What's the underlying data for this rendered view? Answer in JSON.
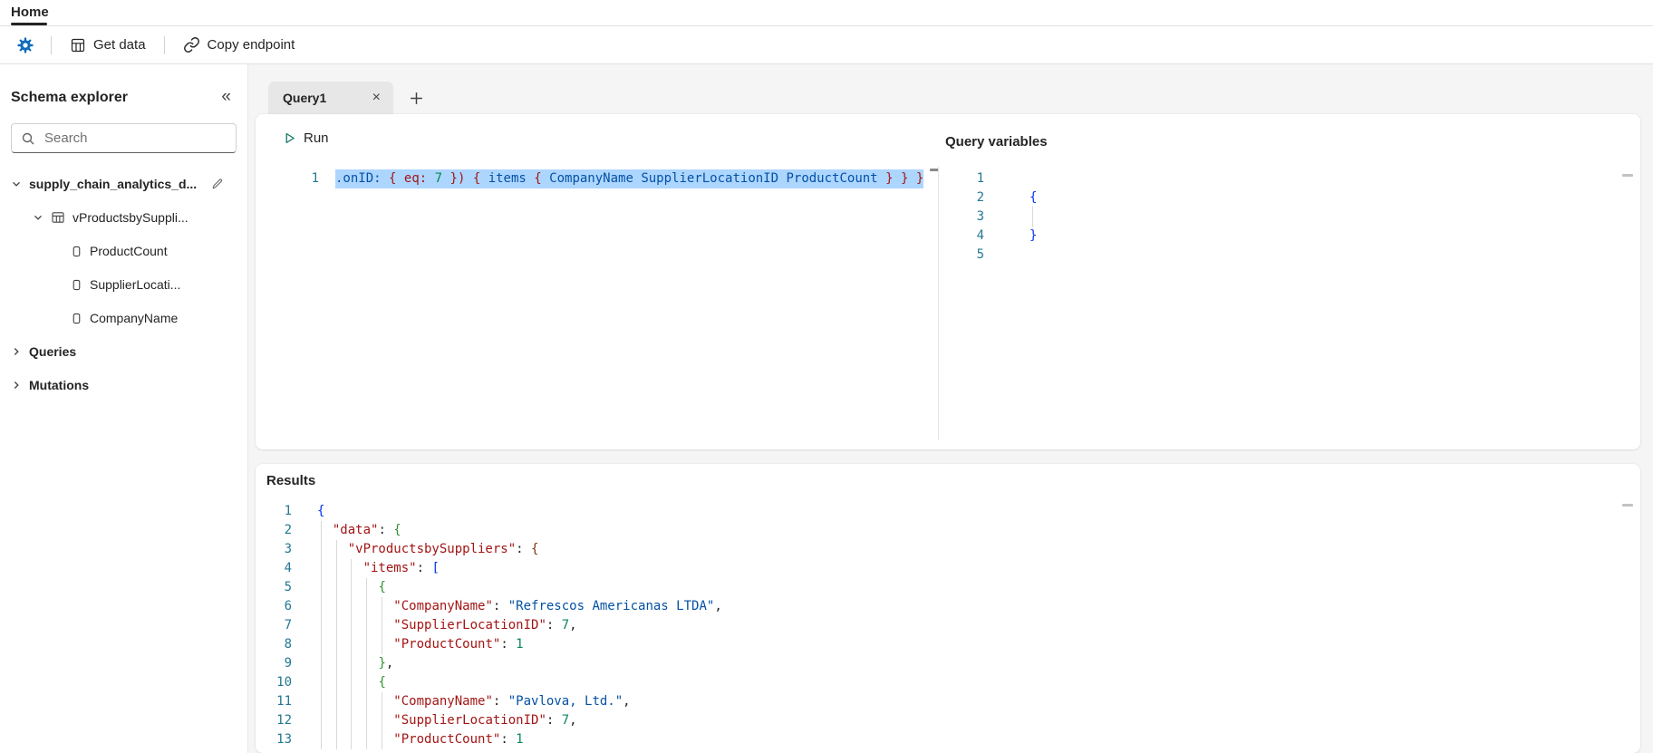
{
  "titlebar": {
    "home_tab": "Home"
  },
  "toolbar": {
    "get_data": "Get data",
    "copy_endpoint": "Copy endpoint"
  },
  "sidebar": {
    "title": "Schema explorer",
    "search_placeholder": "Search",
    "tree": [
      {
        "label": "supply_chain_analytics_d...",
        "type": "database",
        "expanded": true
      },
      {
        "label": "vProductsbySuppli...",
        "type": "table",
        "expanded": true
      },
      {
        "label": "ProductCount",
        "type": "field"
      },
      {
        "label": "SupplierLocati...",
        "type": "field"
      },
      {
        "label": "CompanyName",
        "type": "field"
      },
      {
        "label": "Queries",
        "type": "group",
        "expanded": false
      },
      {
        "label": "Mutations",
        "type": "group",
        "expanded": false
      }
    ]
  },
  "tabs": {
    "active": "Query1"
  },
  "query_panel": {
    "run_label": "Run",
    "variables_title": "Query variables"
  },
  "results_panel": {
    "title": "Results"
  },
  "code": {
    "query": {
      "lines": [
        {
          "selected": true,
          "tokens": [
            [
              "id",
              ".onID:"
            ],
            [
              "p",
              " "
            ],
            [
              "brq",
              "{"
            ],
            [
              "p",
              " "
            ],
            [
              "arg",
              "eq:"
            ],
            [
              "p",
              " "
            ],
            [
              "num",
              "7"
            ],
            [
              "p",
              " "
            ],
            [
              "brq",
              "}"
            ],
            [
              "brq",
              ")"
            ],
            [
              "p",
              " "
            ],
            [
              "brq",
              "{"
            ],
            [
              "p",
              " "
            ],
            [
              "id",
              "items"
            ],
            [
              "p",
              " "
            ],
            [
              "brq",
              "{"
            ],
            [
              "p",
              " "
            ],
            [
              "id",
              "CompanyName"
            ],
            [
              "p",
              " "
            ],
            [
              "id",
              "SupplierLocationID"
            ],
            [
              "p",
              " "
            ],
            [
              "id",
              "ProductCount"
            ],
            [
              "p",
              " "
            ],
            [
              "brq",
              "}"
            ],
            [
              "p",
              " "
            ],
            [
              "brq",
              "}"
            ],
            [
              "p",
              " "
            ],
            [
              "brq",
              "}"
            ]
          ]
        }
      ]
    },
    "variables": {
      "lines": [
        {
          "tokens": []
        },
        {
          "tokens": [
            [
              "b1",
              "{"
            ]
          ]
        },
        {
          "tokens": []
        },
        {
          "tokens": [
            [
              "b1",
              "}"
            ]
          ]
        },
        {
          "tokens": []
        }
      ]
    },
    "results": {
      "lines": [
        {
          "tokens": [
            [
              "b1",
              "{"
            ]
          ]
        },
        {
          "tokens": [
            [
              "p",
              "  "
            ],
            [
              "k",
              "\"data\""
            ],
            [
              "p",
              ": "
            ],
            [
              "b2",
              "{"
            ]
          ]
        },
        {
          "tokens": [
            [
              "p",
              "    "
            ],
            [
              "k",
              "\"vProductsbySuppliers\""
            ],
            [
              "p",
              ": "
            ],
            [
              "b3",
              "{"
            ]
          ]
        },
        {
          "tokens": [
            [
              "p",
              "      "
            ],
            [
              "k",
              "\"items\""
            ],
            [
              "p",
              ": "
            ],
            [
              "b1",
              "["
            ]
          ]
        },
        {
          "tokens": [
            [
              "p",
              "        "
            ],
            [
              "b2",
              "{"
            ]
          ]
        },
        {
          "tokens": [
            [
              "p",
              "          "
            ],
            [
              "k",
              "\"CompanyName\""
            ],
            [
              "p",
              ": "
            ],
            [
              "v",
              "\"Refrescos Americanas LTDA\""
            ],
            [
              "p",
              ","
            ]
          ]
        },
        {
          "tokens": [
            [
              "p",
              "          "
            ],
            [
              "k",
              "\"SupplierLocationID\""
            ],
            [
              "p",
              ": "
            ],
            [
              "num",
              "7"
            ],
            [
              "p",
              ","
            ]
          ]
        },
        {
          "tokens": [
            [
              "p",
              "          "
            ],
            [
              "k",
              "\"ProductCount\""
            ],
            [
              "p",
              ": "
            ],
            [
              "num",
              "1"
            ]
          ]
        },
        {
          "tokens": [
            [
              "p",
              "        "
            ],
            [
              "b2",
              "}"
            ],
            [
              "p",
              ","
            ]
          ]
        },
        {
          "tokens": [
            [
              "p",
              "        "
            ],
            [
              "b2",
              "{"
            ]
          ]
        },
        {
          "tokens": [
            [
              "p",
              "          "
            ],
            [
              "k",
              "\"CompanyName\""
            ],
            [
              "p",
              ": "
            ],
            [
              "v",
              "\"Pavlova, Ltd.\""
            ],
            [
              "p",
              ","
            ]
          ]
        },
        {
          "tokens": [
            [
              "p",
              "          "
            ],
            [
              "k",
              "\"SupplierLocationID\""
            ],
            [
              "p",
              ": "
            ],
            [
              "num",
              "7"
            ],
            [
              "p",
              ","
            ]
          ]
        },
        {
          "tokens": [
            [
              "p",
              "          "
            ],
            [
              "k",
              "\"ProductCount\""
            ],
            [
              "p",
              ": "
            ],
            [
              "num",
              "1"
            ]
          ]
        }
      ]
    }
  },
  "colors": {
    "accent": "#0f6cbd",
    "run_icon": "#117865",
    "selection": "#add6ff",
    "line_number": "#237893",
    "json_key": "#a31515",
    "json_string": "#0451a5",
    "json_number": "#098658"
  }
}
